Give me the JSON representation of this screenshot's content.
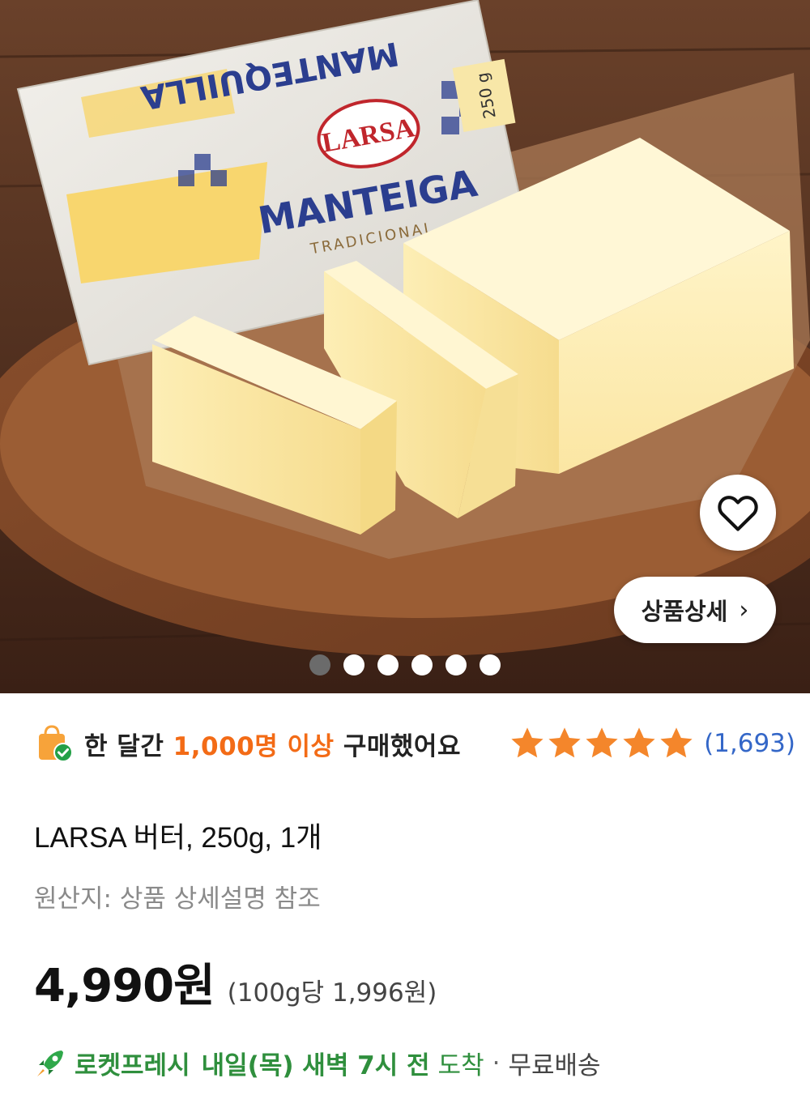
{
  "product_image": {
    "package_brand": "LARSA",
    "package_name": "MANTEIGA",
    "package_subtitle": "TRADICIONAL",
    "package_weight": "250 g",
    "package_back_name": "MANTEQUILLA",
    "carousel": {
      "total": 6,
      "active_index": 0
    }
  },
  "buttons": {
    "detail_label": "상품상세",
    "detail_chevron": "›"
  },
  "purchase_info": {
    "prefix": "한 달간",
    "highlight": "1,000명 이상",
    "suffix": "구매했어요",
    "highlight_color": "#f36b16"
  },
  "rating": {
    "stars": 5,
    "count": "(1,693)",
    "star_color": "#f4862b",
    "count_color": "#3467c8"
  },
  "product": {
    "title": "LARSA 버터, 250g, 1개",
    "origin": "원산지: 상품 상세설명 참조",
    "price": "4,990원",
    "unit_price": "(100g당 1,996원)"
  },
  "delivery": {
    "service": "로켓프레시",
    "date": "내일(목) 새벽 7시 전",
    "arrive": "도착",
    "separator": "·",
    "shipping": "무료배송",
    "accent_color": "#2f8f3d"
  },
  "icons": {
    "wish": "heart-icon",
    "bag": "shopping-bag-check-icon",
    "rocket": "rocket-icon",
    "star": "star-icon"
  }
}
